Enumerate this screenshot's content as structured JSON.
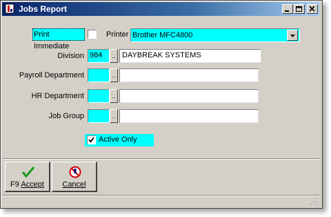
{
  "window": {
    "title": "Jobs Report",
    "controls": {
      "minimize": "_",
      "maximize": "□",
      "close": "×"
    }
  },
  "form": {
    "print_immediate_label": "Print Immediate",
    "print_immediate_checked": false,
    "printer_label": "Printer",
    "printer_value": "Brother MFC4800",
    "division_label": "Division",
    "division_code": "984",
    "division_name": "DAYBREAK SYSTEMS",
    "payroll_department_label": "Payroll Department",
    "payroll_department_code": "",
    "payroll_department_name": "",
    "hr_department_label": "HR Department",
    "hr_department_code": "",
    "hr_department_name": "",
    "job_group_label": "Job Group",
    "job_group_code": "",
    "job_group_name": "",
    "lookup_button_label": "..",
    "active_only_label": "Active Only",
    "active_only_checked": true
  },
  "buttons": {
    "accept_key": "F9",
    "accept_label": "Accept",
    "cancel_label": "Cancel"
  },
  "colors": {
    "highlight": "#00ffff",
    "title_bar": "#0a246a",
    "window_face": "#d4d0c8"
  },
  "icons": {
    "app": "app-icon",
    "accept": "checkmark-icon",
    "cancel": "no-entry-icon"
  }
}
